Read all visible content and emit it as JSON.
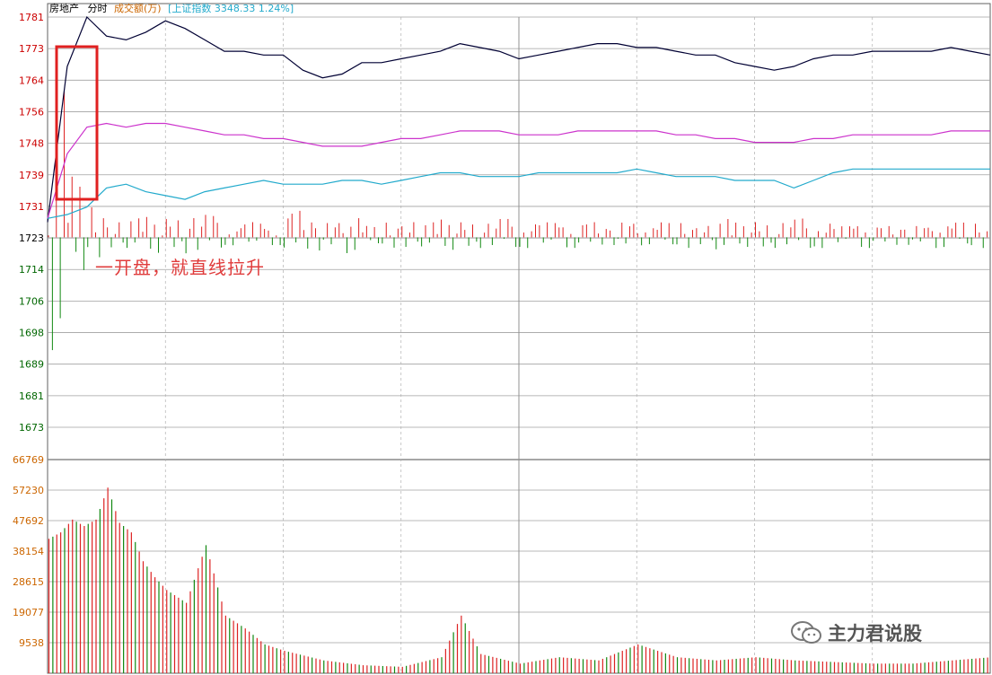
{
  "header": {
    "name": "房地产",
    "mode": "分时",
    "volume_label": "成交额(万)",
    "index_label": "[上证指数",
    "index_value": "3348.33",
    "index_change": "1.24%]"
  },
  "annotation": "一开盘，就直线拉升",
  "watermark": "主力君说股",
  "colors": {
    "price_line": "#000033",
    "avg_line": "#cc33cc",
    "index_line": "#22aacc",
    "up": "#dd2222",
    "down": "#118811",
    "grid": "#a0a0a0",
    "up_label": "#cc0000",
    "down_label": "#006600",
    "volume_label": "#cc6600",
    "highlight_box": "#e02020"
  },
  "chart_data": [
    {
      "type": "line",
      "title": "",
      "y_ticks": [
        "1781",
        "1773",
        "1764",
        "1756",
        "1748",
        "1739",
        "1731",
        "1723",
        "1714",
        "1706",
        "1698",
        "1689",
        "1681",
        "1673"
      ],
      "ylim": [
        1673,
        1781
      ],
      "base_price": 1723,
      "grid": true,
      "x": [
        0,
        5,
        10,
        15,
        20,
        25,
        30,
        35,
        40,
        45,
        50,
        55,
        60,
        65,
        70,
        75,
        80,
        85,
        90,
        95,
        100,
        105,
        110,
        115,
        120,
        125,
        130,
        135,
        140,
        145,
        150,
        155,
        160,
        165,
        170,
        175,
        180,
        185,
        190,
        195,
        200,
        205,
        210,
        215,
        220,
        225,
        230,
        235,
        240
      ],
      "series": [
        {
          "values": [
            1727,
            1768,
            1781,
            1776,
            1775,
            1777,
            1780,
            1778,
            1775,
            1772,
            1772,
            1771,
            1771,
            1767,
            1765,
            1766,
            1769,
            1769,
            1770,
            1771,
            1772,
            1774,
            1773,
            1772,
            1770,
            1771,
            1772,
            1773,
            1774,
            1774,
            1773,
            1773,
            1772,
            1771,
            1771,
            1769,
            1768,
            1767,
            1768,
            1770,
            1771,
            1771,
            1772,
            1772,
            1772,
            1772,
            1773,
            1772,
            1771
          ]
        },
        {
          "values": [
            1728,
            1745,
            1752,
            1753,
            1752,
            1753,
            1753,
            1752,
            1751,
            1750,
            1750,
            1749,
            1749,
            1748,
            1747,
            1747,
            1747,
            1748,
            1749,
            1749,
            1750,
            1751,
            1751,
            1751,
            1750,
            1750,
            1750,
            1751,
            1751,
            1751,
            1751,
            1751,
            1750,
            1750,
            1749,
            1749,
            1748,
            1748,
            1748,
            1749,
            1749,
            1750,
            1750,
            1750,
            1750,
            1750,
            1751,
            1751,
            1751
          ]
        },
        {
          "values": [
            1728,
            1729,
            1731,
            1736,
            1737,
            1735,
            1734,
            1733,
            1735,
            1736,
            1737,
            1738,
            1737,
            1737,
            1737,
            1738,
            1738,
            1737,
            1738,
            1739,
            1740,
            1740,
            1739,
            1739,
            1739,
            1740,
            1740,
            1740,
            1740,
            1740,
            1741,
            1740,
            1739,
            1739,
            1739,
            1738,
            1738,
            1738,
            1736,
            1738,
            1740,
            1741,
            1741,
            1741,
            1741,
            1741,
            1741,
            1741,
            1741
          ]
        }
      ]
    },
    {
      "type": "bar",
      "title": "",
      "ylabel": "成交额(万)",
      "y_ticks": [
        "66769",
        "57230",
        "47692",
        "38154",
        "28615",
        "19077",
        "9538"
      ],
      "ylim": [
        0,
        66769
      ],
      "x": [
        0,
        3,
        6,
        9,
        12,
        15,
        18,
        21,
        24,
        27,
        30,
        35,
        40,
        45,
        50,
        55,
        60,
        70,
        80,
        90,
        100,
        105,
        110,
        120,
        130,
        140,
        150,
        160,
        170,
        180,
        190,
        200,
        210,
        220,
        230,
        240
      ],
      "values": [
        42000,
        44000,
        48000,
        46000,
        48000,
        58000,
        47000,
        44000,
        35000,
        30000,
        26000,
        22000,
        40000,
        18000,
        14000,
        9000,
        7000,
        4000,
        2500,
        2000,
        5000,
        18000,
        6000,
        3000,
        5000,
        4000,
        9000,
        5000,
        4000,
        5000,
        4000,
        3500,
        3000,
        3000,
        4000,
        5000
      ]
    }
  ]
}
